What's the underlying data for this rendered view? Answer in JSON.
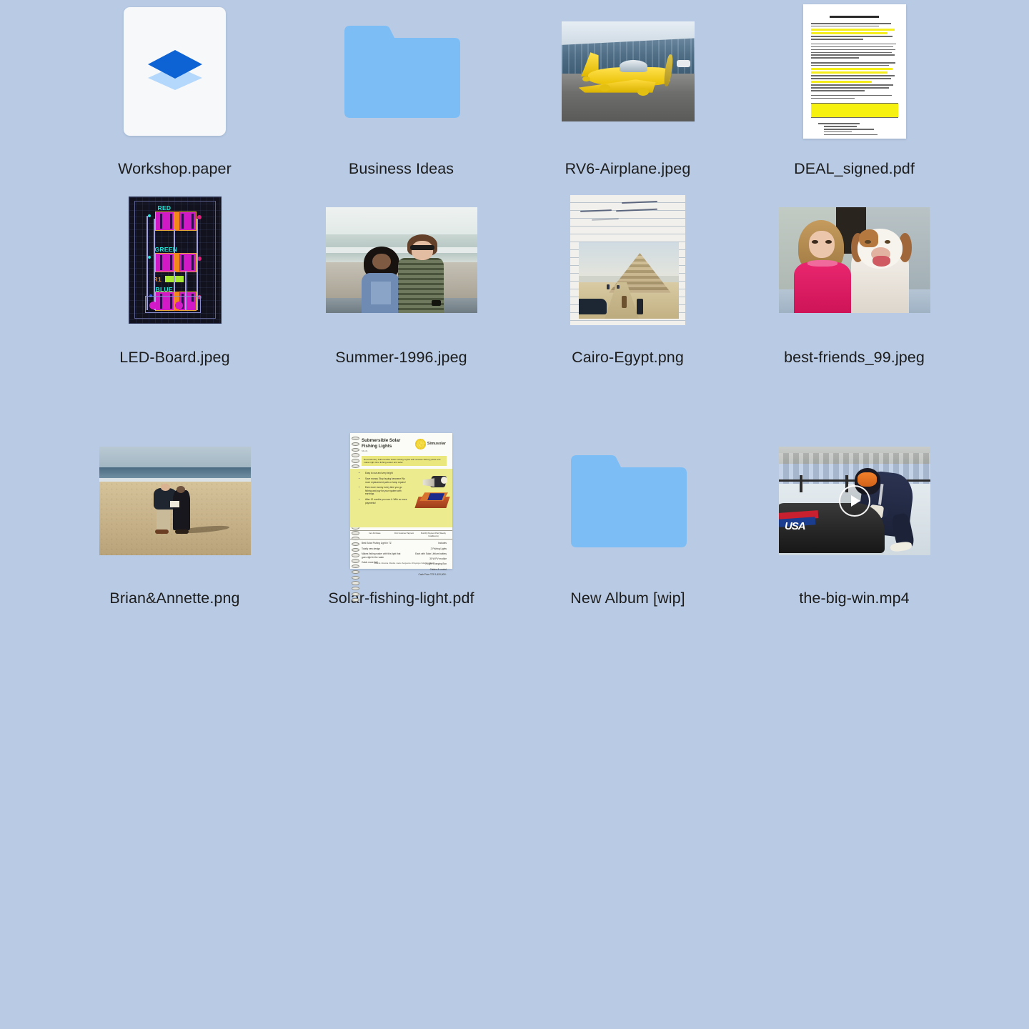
{
  "view": {
    "name": "file-grid",
    "background_color": "#b9cbe4",
    "columns": 4,
    "rows": 3,
    "item_count": 12
  },
  "files": [
    {
      "name": "Workshop.paper",
      "kind": "paper-doc",
      "icon": "dropbox-paper-icon",
      "accent": "#0061fe",
      "accent_light": "#b4d8fb"
    },
    {
      "name": "Business Ideas",
      "kind": "folder",
      "icon": "folder-icon",
      "accent": "#7cbdf5"
    },
    {
      "name": "RV6-Airplane.jpeg",
      "kind": "image",
      "icon": "photo-thumbnail",
      "alt": "Yellow RV6 airplane parked on tarmac in front of a blue metal hangar"
    },
    {
      "name": "DEAL_signed.pdf",
      "kind": "pdf",
      "icon": "document-thumbnail",
      "alt": "Website Design Agreement contract page with yellow highlighted clauses",
      "doc_title": "WEBSITE DESIGN AGREEMENT",
      "highlight_color": "#f7f10f"
    },
    {
      "name": "LED-Board.jpeg",
      "kind": "image",
      "icon": "photo-thumbnail",
      "alt": "PCB layout screenshot on dark background with RGB LED footprints",
      "pcb_labels": [
        "RED",
        "GREEN",
        "BLUE"
      ],
      "pcb_label_color": "#20e8d8"
    },
    {
      "name": "Summer-1996.jpeg",
      "kind": "image",
      "icon": "photo-thumbnail",
      "alt": "Two kids posing at the beach, boy in striped shirt with sunglasses"
    },
    {
      "name": "Cairo-Egypt.png",
      "kind": "image",
      "icon": "photo-thumbnail",
      "alt": "Scrapbook page with handwriting above a photo of the Step Pyramid at Saqqara",
      "handwriting": [
        "February 2006",
        "Nubian Guide, Belgian Tourists"
      ]
    },
    {
      "name": "best-friends_99.jpeg",
      "kind": "image",
      "icon": "photo-thumbnail",
      "alt": "Young girl in a pink sweater sitting next to a smiling beagle"
    },
    {
      "name": "Brian&Annette.png",
      "kind": "image",
      "icon": "photo-thumbnail",
      "alt": "A couple standing on a wide sandy beach looking at a paper"
    },
    {
      "name": "Solar-fishing-light.pdf",
      "kind": "pdf",
      "icon": "document-thumbnail",
      "alt": "Spiral-bound brochure for Submersible Solar Fishing Lights by Simusolar",
      "brochure": {
        "title_line1": "Submersible Solar",
        "title_line2": "Fishing Lights",
        "subtitle": "SFL-01",
        "logo_text": "Simusolar",
        "banner": "Revolutionary Submersible Solar Fishing Lights will increase fishing yields and make night time fishing easier and safer.",
        "bullets": [
          "Easy to use and very bright",
          "Save money. Stop buying kerosene! No more replacement parts or lamp repairs!",
          "Earn more money every time you go fishing and pay for your system with earnings.",
          "After 12 months you own it. With no more payments!"
        ],
        "table_headers": [
          "Item Purchase",
          "First Customer Payment",
          "Monthly Payment Plan (Weekly Installments)"
        ],
        "table_values": [
          "650,000",
          "—",
          "48,000 (24 Mos)"
        ],
        "left_notes": [
          "Best Solar Fishing Light in TZ",
          "Totally new design",
          "Makes fishing easier with this light that goes right in the water",
          "Catch more fish!"
        ],
        "right_heading": "Includes",
        "right_notes": [
          "2 Fishing Lights",
          "Each with Solar Lithium battery",
          "30 W PV module",
          "2 Light Charging Box",
          "Cables & control",
          "Cash Price TZS 1,620,000/-"
        ],
        "footer": "Mwanza • Musoma • Bukoba • Geita • Sengerema • Shinyanga • Kahama • Tabora"
      }
    },
    {
      "name": "New Album [wip]",
      "kind": "folder",
      "icon": "folder-icon",
      "accent": "#7cbdf5"
    },
    {
      "name": "the-big-win.mp4",
      "kind": "video",
      "icon": "video-thumbnail",
      "alt": "Bobsled athlete in USA suit pushing a black sled on an ice track",
      "overlay": "play-icon",
      "sled_text": "USA"
    }
  ]
}
